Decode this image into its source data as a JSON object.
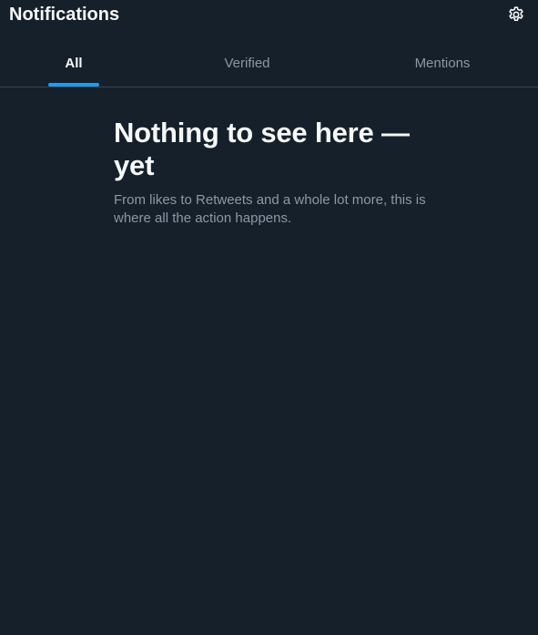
{
  "header": {
    "title": "Notifications",
    "settings_icon": "gear-icon"
  },
  "tabs": [
    {
      "label": "All",
      "active": true
    },
    {
      "label": "Verified",
      "active": false
    },
    {
      "label": "Mentions",
      "active": false
    }
  ],
  "empty_state": {
    "title": "Nothing to see here — yet",
    "description": "From likes to Retweets and a whole lot more, this is where all the action happens."
  },
  "colors": {
    "background": "#15202b",
    "accent": "#1d9bf0",
    "primary_text": "#f7f9f9",
    "secondary_text": "#8b98a5",
    "divider": "#38444d"
  }
}
